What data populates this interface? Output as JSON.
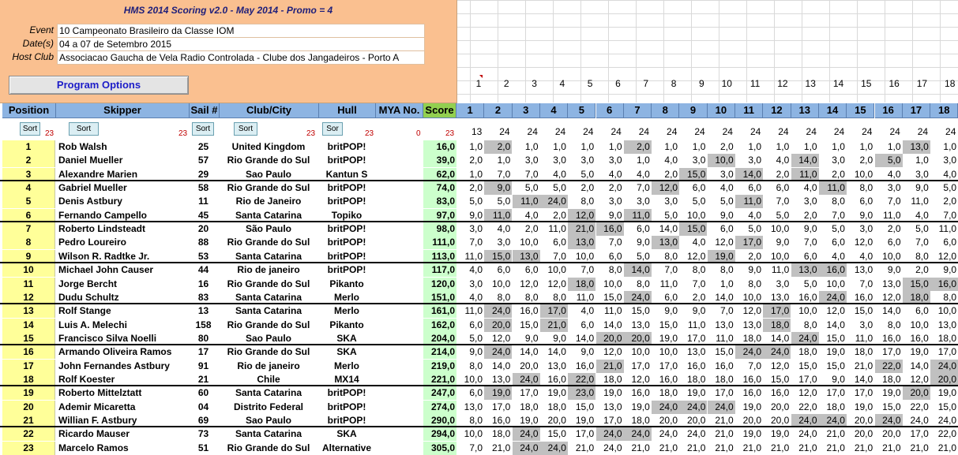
{
  "window": {
    "title": "HMS 2014 Scoring v2.0 - May 2014 - Promo = 4"
  },
  "event_info": [
    {
      "label": "Event",
      "value": "10 Campeonato Brasileiro da Classe IOM"
    },
    {
      "label": "Date(s)",
      "value": "04 a 07 de Setembro 2015"
    },
    {
      "label": "Host Club",
      "value": "Associacao Gaucha de Vela Radio Controlada - Clube dos Jangadeiros - Porto A"
    }
  ],
  "program_options_label": "Program Options",
  "race_numbers": [
    "1",
    "2",
    "3",
    "4",
    "5",
    "6",
    "7",
    "8",
    "9",
    "10",
    "11",
    "12",
    "13",
    "14",
    "15",
    "16",
    "17",
    "18"
  ],
  "headers": {
    "position": "Position",
    "skipper": "Skipper",
    "sail": "Sail #",
    "club": "Club/City",
    "hull": "Hull",
    "mya": "MYA No.",
    "score": "Score"
  },
  "sort": {
    "position": {
      "label": "Sort",
      "count": "23"
    },
    "skipper": {
      "label": "Sort",
      "count": "23"
    },
    "sail": {
      "label": "Sort",
      "count": ""
    },
    "club": {
      "label": "Sort",
      "count": "23"
    },
    "hull": {
      "label": "Sor",
      "count": "23"
    },
    "mya": {
      "label": "",
      "count": "0"
    },
    "score": {
      "label": "",
      "count": "23"
    }
  },
  "race_entry_counts": [
    "13",
    "24",
    "24",
    "24",
    "24",
    "24",
    "24",
    "24",
    "24",
    "24",
    "24",
    "24",
    "24",
    "24",
    "24",
    "24",
    "24",
    "24"
  ],
  "rows": [
    {
      "pos": "1",
      "skipper": "Rob Walsh",
      "sail": "25",
      "club": "United Kingdom",
      "hull": "britPOP!",
      "score": "16,0",
      "races": [
        "1,0",
        "2,0",
        "1,0",
        "1,0",
        "1,0",
        "1,0",
        "2,0",
        "1,0",
        "1,0",
        "2,0",
        "1,0",
        "1,0",
        "1,0",
        "1,0",
        "1,0",
        "1,0",
        "13,0",
        "1,0"
      ],
      "drops": [
        1,
        6,
        16
      ]
    },
    {
      "pos": "2",
      "skipper": "Daniel Mueller",
      "sail": "57",
      "club": "Rio Grande do Sul",
      "hull": "britPOP!",
      "score": "39,0",
      "races": [
        "2,0",
        "1,0",
        "3,0",
        "3,0",
        "3,0",
        "3,0",
        "1,0",
        "4,0",
        "3,0",
        "10,0",
        "3,0",
        "4,0",
        "14,0",
        "3,0",
        "2,0",
        "5,0",
        "1,0",
        "3,0"
      ],
      "drops": [
        9,
        12,
        15
      ]
    },
    {
      "pos": "3",
      "skipper": "Alexandre Marien",
      "sail": "29",
      "club": "Sao Paulo",
      "hull": "Kantun S",
      "score": "62,0",
      "races": [
        "1,0",
        "7,0",
        "7,0",
        "4,0",
        "5,0",
        "4,0",
        "4,0",
        "2,0",
        "15,0",
        "3,0",
        "14,0",
        "2,0",
        "11,0",
        "2,0",
        "10,0",
        "4,0",
        "3,0",
        "4,0"
      ],
      "drops": [
        8,
        10,
        12
      ]
    },
    {
      "pos": "4",
      "skipper": "Gabriel Mueller",
      "sail": "58",
      "club": "Rio Grande do Sul",
      "hull": "britPOP!",
      "score": "74,0",
      "races": [
        "2,0",
        "9,0",
        "5,0",
        "5,0",
        "2,0",
        "2,0",
        "7,0",
        "12,0",
        "6,0",
        "4,0",
        "6,0",
        "6,0",
        "4,0",
        "11,0",
        "8,0",
        "3,0",
        "9,0",
        "5,0"
      ],
      "drops": [
        1,
        7,
        13
      ]
    },
    {
      "pos": "5",
      "skipper": "Denis Astbury",
      "sail": "11",
      "club": "Rio de Janeiro",
      "hull": "britPOP!",
      "score": "83,0",
      "races": [
        "5,0",
        "5,0",
        "11,0",
        "24,0",
        "8,0",
        "3,0",
        "3,0",
        "3,0",
        "5,0",
        "5,0",
        "11,0",
        "7,0",
        "3,0",
        "8,0",
        "6,0",
        "7,0",
        "11,0",
        "2,0"
      ],
      "drops": [
        2,
        3,
        10
      ]
    },
    {
      "pos": "6",
      "skipper": "Fernando Campello",
      "sail": "45",
      "club": "Santa Catarina",
      "hull": "Topiko",
      "score": "97,0",
      "races": [
        "9,0",
        "11,0",
        "4,0",
        "2,0",
        "12,0",
        "9,0",
        "11,0",
        "5,0",
        "10,0",
        "9,0",
        "4,0",
        "5,0",
        "2,0",
        "7,0",
        "9,0",
        "11,0",
        "4,0",
        "7,0"
      ],
      "drops": [
        1,
        4,
        6
      ]
    },
    {
      "pos": "7",
      "skipper": "Roberto Lindsteadt",
      "sail": "20",
      "club": "São Paulo",
      "hull": "britPOP!",
      "score": "98,0",
      "races": [
        "3,0",
        "4,0",
        "2,0",
        "11,0",
        "21,0",
        "16,0",
        "6,0",
        "14,0",
        "15,0",
        "6,0",
        "5,0",
        "10,0",
        "9,0",
        "5,0",
        "3,0",
        "2,0",
        "5,0",
        "11,0"
      ],
      "drops": [
        4,
        5,
        8
      ]
    },
    {
      "pos": "8",
      "skipper": "Pedro Loureiro",
      "sail": "88",
      "club": "Rio Grande do Sul",
      "hull": "britPOP!",
      "score": "111,0",
      "races": [
        "7,0",
        "3,0",
        "10,0",
        "6,0",
        "13,0",
        "7,0",
        "9,0",
        "13,0",
        "4,0",
        "12,0",
        "17,0",
        "9,0",
        "7,0",
        "6,0",
        "12,0",
        "6,0",
        "7,0",
        "6,0"
      ],
      "drops": [
        4,
        7,
        10
      ]
    },
    {
      "pos": "9",
      "skipper": "Wilson R. Radtke Jr.",
      "sail": "53",
      "club": "Santa Catarina",
      "hull": "britPOP!",
      "score": "113,0",
      "races": [
        "11,0",
        "15,0",
        "13,0",
        "7,0",
        "10,0",
        "6,0",
        "5,0",
        "8,0",
        "12,0",
        "19,0",
        "2,0",
        "10,0",
        "6,0",
        "4,0",
        "4,0",
        "10,0",
        "8,0",
        "12,0"
      ],
      "drops": [
        1,
        2,
        9
      ]
    },
    {
      "pos": "10",
      "skipper": "Michael John Causer",
      "sail": "44",
      "club": "Rio de janeiro",
      "hull": "britPOP!",
      "score": "117,0",
      "races": [
        "4,0",
        "6,0",
        "6,0",
        "10,0",
        "7,0",
        "8,0",
        "14,0",
        "7,0",
        "8,0",
        "8,0",
        "9,0",
        "11,0",
        "13,0",
        "16,0",
        "13,0",
        "9,0",
        "2,0",
        "9,0"
      ],
      "drops": [
        6,
        12,
        13
      ]
    },
    {
      "pos": "11",
      "skipper": "Jorge Bercht",
      "sail": "16",
      "club": "Rio Grande do Sul",
      "hull": "Pikanto",
      "score": "120,0",
      "races": [
        "3,0",
        "10,0",
        "12,0",
        "12,0",
        "18,0",
        "10,0",
        "8,0",
        "11,0",
        "7,0",
        "1,0",
        "8,0",
        "3,0",
        "5,0",
        "10,0",
        "7,0",
        "13,0",
        "15,0",
        "16,0"
      ],
      "drops": [
        4,
        16,
        17
      ]
    },
    {
      "pos": "12",
      "skipper": "Dudu Schultz",
      "sail": "83",
      "club": "Santa Catarina",
      "hull": "Merlo",
      "score": "151,0",
      "races": [
        "4,0",
        "8,0",
        "8,0",
        "8,0",
        "11,0",
        "15,0",
        "24,0",
        "6,0",
        "2,0",
        "14,0",
        "10,0",
        "13,0",
        "16,0",
        "24,0",
        "16,0",
        "12,0",
        "18,0",
        "8,0"
      ],
      "drops": [
        6,
        13,
        16
      ]
    },
    {
      "pos": "13",
      "skipper": "Rolf Stange",
      "sail": "13",
      "club": "Santa Catarina",
      "hull": "Merlo",
      "score": "161,0",
      "races": [
        "11,0",
        "24,0",
        "16,0",
        "17,0",
        "4,0",
        "11,0",
        "15,0",
        "9,0",
        "9,0",
        "7,0",
        "12,0",
        "17,0",
        "10,0",
        "12,0",
        "15,0",
        "14,0",
        "6,0",
        "10,0"
      ],
      "drops": [
        1,
        3,
        11
      ]
    },
    {
      "pos": "14",
      "skipper": "Luis A. Melechi",
      "sail": "158",
      "club": "Rio Grande do Sul",
      "hull": "Pikanto",
      "score": "162,0",
      "races": [
        "6,0",
        "20,0",
        "15,0",
        "21,0",
        "6,0",
        "14,0",
        "13,0",
        "15,0",
        "11,0",
        "13,0",
        "13,0",
        "18,0",
        "8,0",
        "14,0",
        "3,0",
        "8,0",
        "10,0",
        "13,0"
      ],
      "drops": [
        1,
        3,
        11
      ]
    },
    {
      "pos": "15",
      "skipper": "Francisco Silva Noelli",
      "sail": "80",
      "club": "Sao Paulo",
      "hull": "SKA",
      "score": "204,0",
      "races": [
        "5,0",
        "12,0",
        "9,0",
        "9,0",
        "14,0",
        "20,0",
        "20,0",
        "19,0",
        "17,0",
        "11,0",
        "18,0",
        "14,0",
        "24,0",
        "15,0",
        "11,0",
        "16,0",
        "16,0",
        "18,0"
      ],
      "drops": [
        5,
        6,
        12
      ]
    },
    {
      "pos": "16",
      "skipper": "Armando Oliveira Ramos",
      "sail": "17",
      "club": "Rio Grande do Sul",
      "hull": "SKA",
      "score": "214,0",
      "races": [
        "9,0",
        "24,0",
        "14,0",
        "14,0",
        "9,0",
        "12,0",
        "10,0",
        "10,0",
        "13,0",
        "15,0",
        "24,0",
        "24,0",
        "18,0",
        "19,0",
        "18,0",
        "17,0",
        "19,0",
        "17,0"
      ],
      "drops": [
        1,
        10,
        11
      ]
    },
    {
      "pos": "17",
      "skipper": "John Fernandes Astbury",
      "sail": "91",
      "club": "Rio de janeiro",
      "hull": "Merlo",
      "score": "219,0",
      "races": [
        "8,0",
        "14,0",
        "20,0",
        "13,0",
        "16,0",
        "21,0",
        "17,0",
        "17,0",
        "16,0",
        "16,0",
        "7,0",
        "12,0",
        "15,0",
        "15,0",
        "21,0",
        "22,0",
        "14,0",
        "24,0"
      ],
      "drops": [
        5,
        15,
        17
      ]
    },
    {
      "pos": "18",
      "skipper": "Rolf Koester",
      "sail": "21",
      "club": "Chile",
      "hull": "MX14",
      "score": "221,0",
      "races": [
        "10,0",
        "13,0",
        "24,0",
        "16,0",
        "22,0",
        "18,0",
        "12,0",
        "16,0",
        "18,0",
        "18,0",
        "16,0",
        "15,0",
        "17,0",
        "9,0",
        "14,0",
        "18,0",
        "12,0",
        "20,0"
      ],
      "drops": [
        2,
        4,
        17
      ]
    },
    {
      "pos": "19",
      "skipper": "Roberto Mittelztatt",
      "sail": "60",
      "club": "Santa Catarina",
      "hull": "britPOP!",
      "score": "247,0",
      "races": [
        "6,0",
        "19,0",
        "17,0",
        "19,0",
        "23,0",
        "19,0",
        "16,0",
        "18,0",
        "19,0",
        "17,0",
        "16,0",
        "16,0",
        "12,0",
        "17,0",
        "17,0",
        "19,0",
        "20,0",
        "19,0"
      ],
      "drops": [
        1,
        4,
        16
      ]
    },
    {
      "pos": "20",
      "skipper": "Ademir Micaretta",
      "sail": "04",
      "club": "Distrito Federal",
      "hull": "britPOP!",
      "score": "274,0",
      "races": [
        "13,0",
        "17,0",
        "18,0",
        "18,0",
        "15,0",
        "13,0",
        "19,0",
        "24,0",
        "24,0",
        "24,0",
        "19,0",
        "20,0",
        "22,0",
        "18,0",
        "19,0",
        "15,0",
        "22,0",
        "15,0"
      ],
      "drops": [
        7,
        8,
        9
      ]
    },
    {
      "pos": "21",
      "skipper": "Willian F. Astbury",
      "sail": "69",
      "club": "Sao Paulo",
      "hull": "britPOP!",
      "score": "290,0",
      "races": [
        "8,0",
        "16,0",
        "19,0",
        "20,0",
        "19,0",
        "17,0",
        "18,0",
        "20,0",
        "20,0",
        "21,0",
        "20,0",
        "20,0",
        "24,0",
        "24,0",
        "20,0",
        "24,0",
        "24,0",
        "24,0"
      ],
      "drops": [
        12,
        13,
        15
      ]
    },
    {
      "pos": "22",
      "skipper": "Ricardo Mauser",
      "sail": "73",
      "club": "Santa Catarina",
      "hull": "SKA",
      "score": "294,0",
      "races": [
        "10,0",
        "18,0",
        "24,0",
        "15,0",
        "17,0",
        "24,0",
        "24,0",
        "24,0",
        "24,0",
        "21,0",
        "19,0",
        "19,0",
        "24,0",
        "21,0",
        "20,0",
        "20,0",
        "17,0",
        "22,0"
      ],
      "drops": [
        2,
        5,
        6
      ]
    },
    {
      "pos": "23",
      "skipper": "Marcelo Ramos",
      "sail": "51",
      "club": "Rio Grande do Sul",
      "hull": "Alternative",
      "score": "305,0",
      "races": [
        "7,0",
        "21,0",
        "24,0",
        "24,0",
        "21,0",
        "24,0",
        "21,0",
        "21,0",
        "21,0",
        "21,0",
        "21,0",
        "21,0",
        "21,0",
        "21,0",
        "21,0",
        "21,0",
        "21,0",
        "21,0"
      ],
      "drops": [
        2,
        3
      ]
    }
  ],
  "colors": {
    "info_bg": "#fac090",
    "header_bg": "#8db4e2",
    "score_header_bg": "#92d050",
    "position_bg": "#ffff99",
    "score_bg": "#ccffcc",
    "drop_bg": "#c0c0c0",
    "title_color": "#1f1f7a",
    "options_text": "#1c1cc8"
  }
}
